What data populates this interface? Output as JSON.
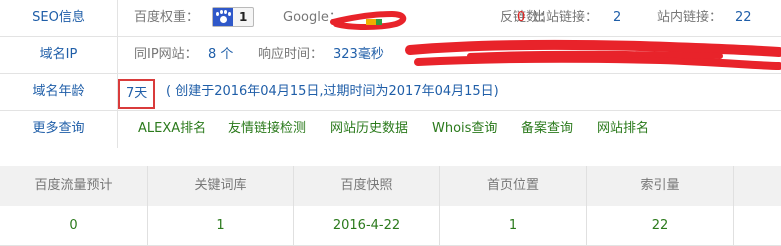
{
  "seo": {
    "label": "SEO信息",
    "baidu_weight_label": "百度权重：",
    "baidu_weight_value": "1",
    "google_label": "Google：",
    "backlinks_label": "反链数：",
    "backlinks_value": "0",
    "outbound_label": "出站链接：",
    "outbound_value": "2",
    "internal_label": "站内链接：",
    "internal_value": "22"
  },
  "domain_ip": {
    "label": "域名IP",
    "same_ip_label": "同IP网站：",
    "same_ip_value": "8 个",
    "response_label": "响应时间：",
    "response_value": "323毫秒"
  },
  "domain_age": {
    "label": "域名年龄",
    "age_value": "7天",
    "detail": "( 创建于2016年04月15日,过期时间为2017年04月15日)"
  },
  "more": {
    "label": "更多查询",
    "links": [
      "ALEXA排名",
      "友情链接检测",
      "网站历史数据",
      "Whois查询",
      "备案查询",
      "网站排名"
    ]
  },
  "stats": {
    "headers": [
      "百度流量预计",
      "关键词库",
      "百度快照",
      "首页位置",
      "索引量"
    ],
    "values": [
      "0",
      "1",
      "2016-4-22",
      "1",
      "22"
    ]
  },
  "colors": {
    "label_blue": "#1f5ea8",
    "link_green": "#2b7a1c",
    "value_red": "#e0211f",
    "redaction": "#e8232a"
  }
}
